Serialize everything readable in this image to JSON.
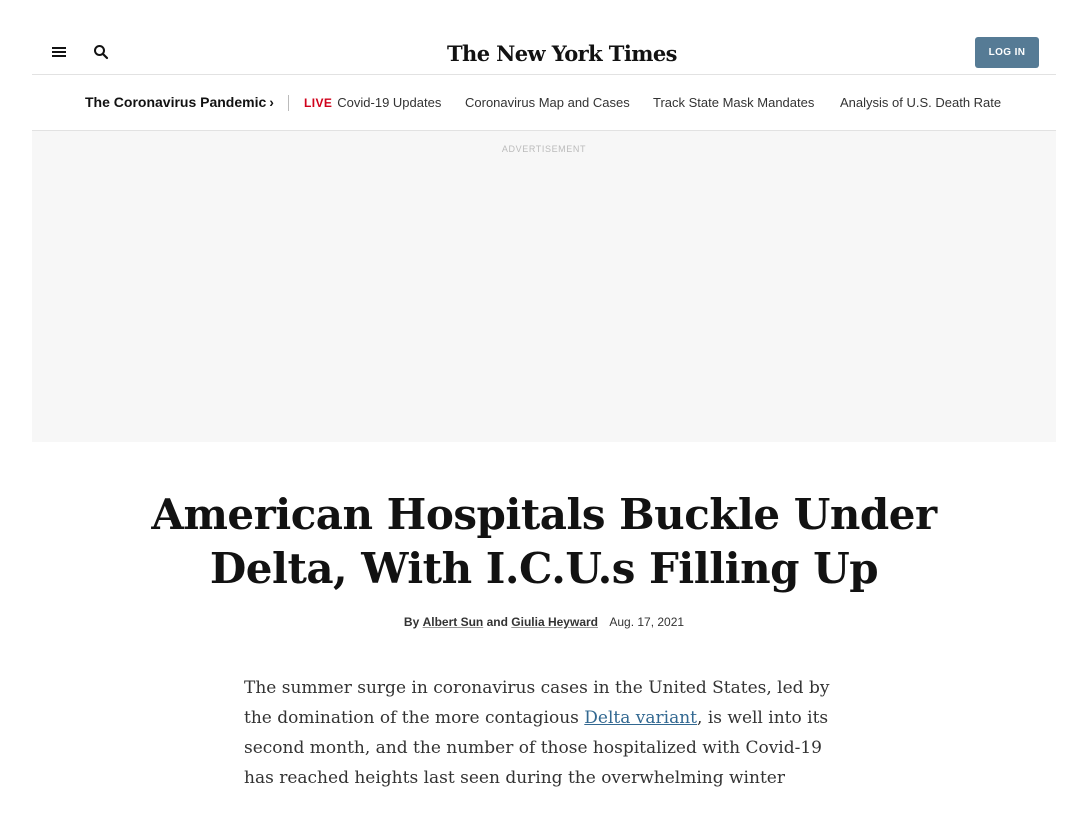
{
  "header": {
    "logo_text": "The New York Times",
    "login_label": "LOG IN",
    "login_color": "#567b95"
  },
  "icons": {
    "menu": "hamburger-menu-icon",
    "search": "search-icon"
  },
  "subnav": {
    "section_label": "The Coronavirus Pandemic",
    "live_label": "LIVE",
    "live_color": "#d0021b",
    "links": [
      "Covid-19 Updates",
      "Coronavirus Map and Cases",
      "Track State Mask Mandates",
      "Analysis of U.S. Death Rate"
    ]
  },
  "ad": {
    "label": "ADVERTISEMENT"
  },
  "article": {
    "headline_line1": "American Hospitals Buckle Under",
    "headline_line2": "Delta, With I.C.U.s Filling Up",
    "byline_by": "By",
    "author1": "Albert Sun",
    "byline_and": "and",
    "author2": "Giulia Heyward",
    "date": "Aug. 17, 2021",
    "body_before_link": "The summer surge in coronavirus cases in the United States, led by the domination of the more contagious ",
    "body_link": "Delta variant",
    "body_after_link": ", is well into its second month, and the number of those hospitalized with Covid-19 has reached heights last seen during the overwhelming winter",
    "link_color": "#326891"
  }
}
